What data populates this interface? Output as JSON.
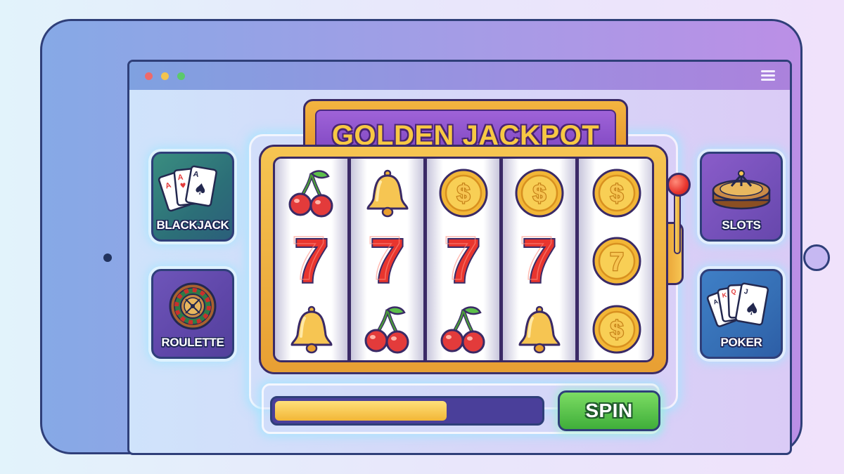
{
  "window": {
    "menu_icon": "hamburger-menu-icon"
  },
  "machine": {
    "title": "GOLDEN JACKPOT",
    "reels": [
      [
        "cherry",
        "seven",
        "bell"
      ],
      [
        "bell",
        "seven",
        "cherry"
      ],
      [
        "coin",
        "seven",
        "cherry"
      ],
      [
        "coin",
        "seven",
        "bell"
      ],
      [
        "coin",
        "coin-seven",
        "coin"
      ]
    ]
  },
  "games": {
    "left": [
      {
        "label": "BLACKJACK",
        "icon": "playing-cards-icon"
      },
      {
        "label": "ROULETTE",
        "icon": "roulette-wheel-icon"
      }
    ],
    "right": [
      {
        "label": "SLOTS",
        "icon": "roulette-table-icon"
      },
      {
        "label": "POKER",
        "icon": "poker-cards-icon"
      }
    ]
  },
  "controls": {
    "progress": 0.65,
    "spin_label": "SPIN"
  },
  "colors": {
    "accent_gold": "#f6c552",
    "banner_purple": "#8b52cc",
    "spin_green": "#4fbf45",
    "seven_red": "#e8352e"
  }
}
